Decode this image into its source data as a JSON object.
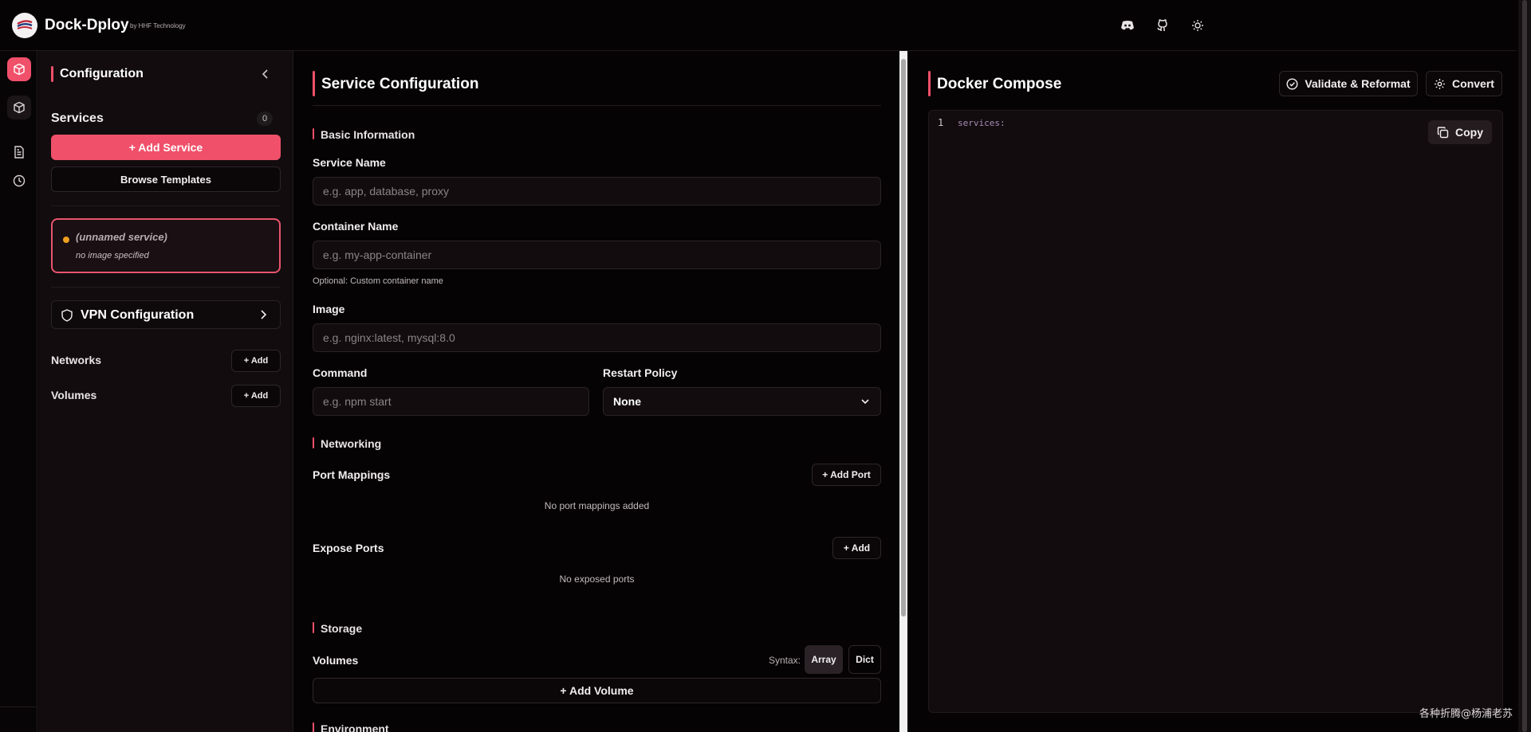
{
  "header": {
    "brand_title": "Dock-Dploy",
    "brand_subtitle": "by HHF Technology",
    "icons": [
      "discord-icon",
      "github-icon",
      "sun-icon"
    ]
  },
  "rail": {
    "icons": [
      "cube-icon",
      "cube-icon",
      "document-icon",
      "clock-icon"
    ]
  },
  "config": {
    "title": "Configuration",
    "services_label": "Services",
    "services_count": "0",
    "add_service_label": "+ Add Service",
    "browse_templates_label": "Browse Templates",
    "service_card": {
      "name": "(unnamed service)",
      "subtitle": "no image specified"
    },
    "vpn_label": "VPN Configuration",
    "networks_label": "Networks",
    "volumes_label": "Volumes",
    "add_label": "+ Add"
  },
  "service_panel": {
    "title": "Service Configuration",
    "basic_info_heading": "Basic Information",
    "service_name_label": "Service Name",
    "service_name_placeholder": "e.g. app, database, proxy",
    "container_name_label": "Container Name",
    "container_name_placeholder": "e.g. my-app-container",
    "container_name_hint": "Optional: Custom container name",
    "image_label": "Image",
    "image_placeholder": "e.g. nginx:latest, mysql:8.0",
    "command_label": "Command",
    "command_placeholder": "e.g. npm start",
    "restart_policy_label": "Restart Policy",
    "restart_policy_value": "None",
    "networking_heading": "Networking",
    "port_mappings_label": "Port Mappings",
    "add_port_label": "+ Add Port",
    "no_ports_msg": "No port mappings added",
    "expose_ports_label": "Expose Ports",
    "expose_add_label": "+ Add",
    "no_exposed_msg": "No exposed ports",
    "storage_heading": "Storage",
    "volumes_label": "Volumes",
    "syntax_label": "Syntax:",
    "syntax_array": "Array",
    "syntax_dict": "Dict",
    "add_volume_label": "+ Add Volume",
    "environment_heading": "Environment"
  },
  "compose": {
    "title": "Docker Compose",
    "validate_label": "Validate & Reformat",
    "convert_label": "Convert",
    "copy_label": "Copy",
    "line_number": "1",
    "code_text": "services:"
  },
  "watermark": "各种折腾@杨浦老苏",
  "colors": {
    "accent": "#f0506a",
    "background": "#050304",
    "sidebar": "#120c0e",
    "status_dot": "#f0a020"
  }
}
